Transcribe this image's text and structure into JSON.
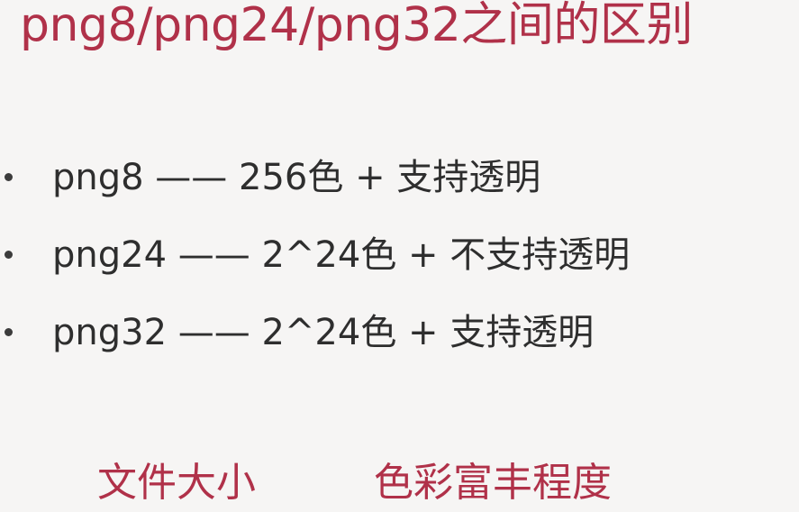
{
  "title": "png8/png24/png32之间的区别",
  "bullets": [
    {
      "text": "png8 —— 256色 + 支持透明"
    },
    {
      "text": "png24 —— 2^24色 + 不支持透明"
    },
    {
      "text": "png32 —— 2^24色 + 支持透明"
    }
  ],
  "footer": {
    "left": "文件大小",
    "right": "色彩富丰程度"
  },
  "colors": {
    "accent": "#b03149",
    "text": "#2e2e2e",
    "background": "#f6f5f4"
  }
}
